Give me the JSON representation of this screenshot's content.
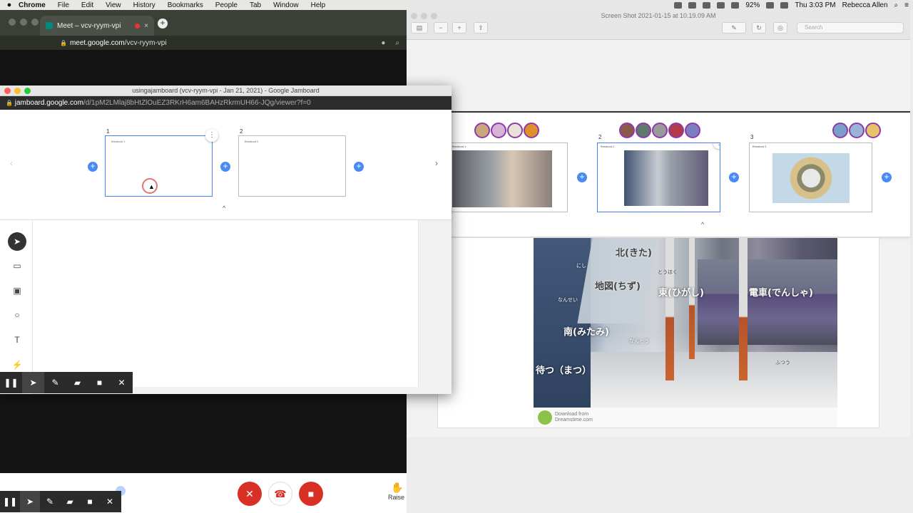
{
  "menubar": {
    "apple": "",
    "items": [
      "Chrome",
      "File",
      "Edit",
      "View",
      "History",
      "Bookmarks",
      "People",
      "Tab",
      "Window",
      "Help"
    ],
    "battery": "92%",
    "clock": "Thu 3:03 PM",
    "user": "Rebecca Allen"
  },
  "meet": {
    "tab_title": "Meet – vcv-ryym-vpi",
    "tab_close": "×",
    "new_tab": "+",
    "url_host": "meet.google.com",
    "url_path": "/vcv-ryym-vpi",
    "raise_hand": "Raise hand"
  },
  "jamboard": {
    "window_title": "usingajamboard (vcv-ryym-vpi - Jan 21, 2021) - Google Jamboard",
    "url_host": "jamboard.google.com",
    "url_path": "/d/1pM2LMlaj8bHtZlOuEZ3RKrH6am6BAHzRkrmUH66-JQg/viewer?f=0",
    "frames": [
      {
        "number": "1",
        "label": "Breakout 1"
      },
      {
        "number": "2",
        "label": "Breakout 2"
      }
    ],
    "plus": "+",
    "kebab": "⋮",
    "prev": "‹",
    "next": "›",
    "collapse": "^"
  },
  "preview": {
    "title": "Screen Shot 2021-01-15 at 10.19.09 AM",
    "search_placeholder": "Search",
    "frames": [
      {
        "number": "",
        "label": "Breakout 1"
      },
      {
        "number": "2",
        "label": "Breakout 2"
      },
      {
        "number": "3",
        "label": "Breakout 3"
      }
    ],
    "board_labels": {
      "kita": "北(きた)",
      "nishi": "にし",
      "touhoku": "とうほく",
      "chizu": "地図(ちず)",
      "higashi": "東(ひがし)",
      "densha": "電車(でんしゃ)",
      "nansei": "なんせい",
      "minami": "南(みたみ)",
      "nantou": "なんとう",
      "matsu": "待つ（まつ）",
      "futsuu": "ふつう"
    },
    "download_line1": "Download from",
    "download_line2": "Dreamstime.com",
    "colors": {
      "avatar_ring": "#8e3aa8",
      "plus": "#4a8af4",
      "red": "#d93025"
    }
  }
}
